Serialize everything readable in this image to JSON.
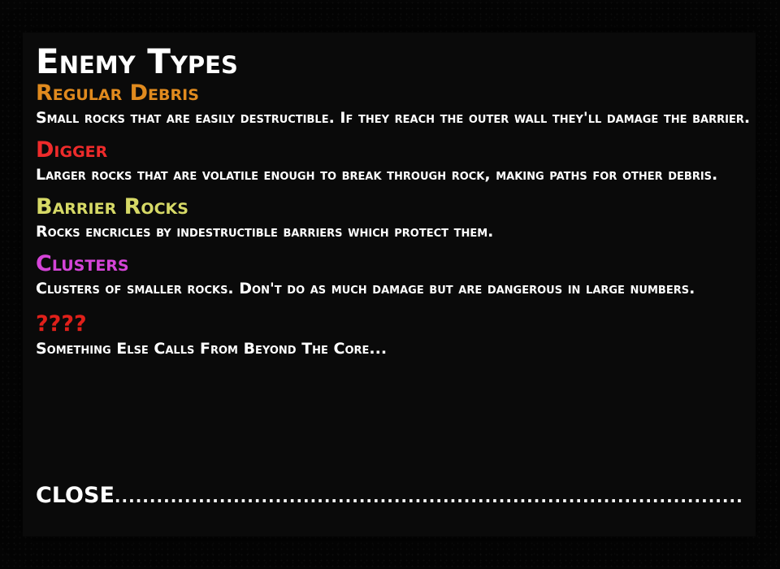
{
  "panel": {
    "title": "Enemy Types"
  },
  "enemies": [
    {
      "name": "Regular Debris",
      "color": "#e08a1e",
      "description": "Small rocks that are easily destructible. If they reach the outer wall they'll damage the barrier."
    },
    {
      "name": "Digger",
      "color": "#ee2b2b",
      "description": "Larger rocks that are volatile enough to break through rock, making paths for other debris."
    },
    {
      "name": "Barrier Rocks",
      "color": "#d6d966",
      "description": "Rocks encricles by indestructible barriers which protect them."
    },
    {
      "name": "Clusters",
      "color": "#d544d8",
      "description": "Clusters of smaller rocks. Don't do as much damage but are dangerous in large numbers."
    },
    {
      "name": "????",
      "color": "#e0201a",
      "description": "Something Else Calls From Beyond The Core..."
    }
  ],
  "close_button": {
    "label": "CLOSE",
    "leader": "..............................................................................................................................................................................."
  }
}
